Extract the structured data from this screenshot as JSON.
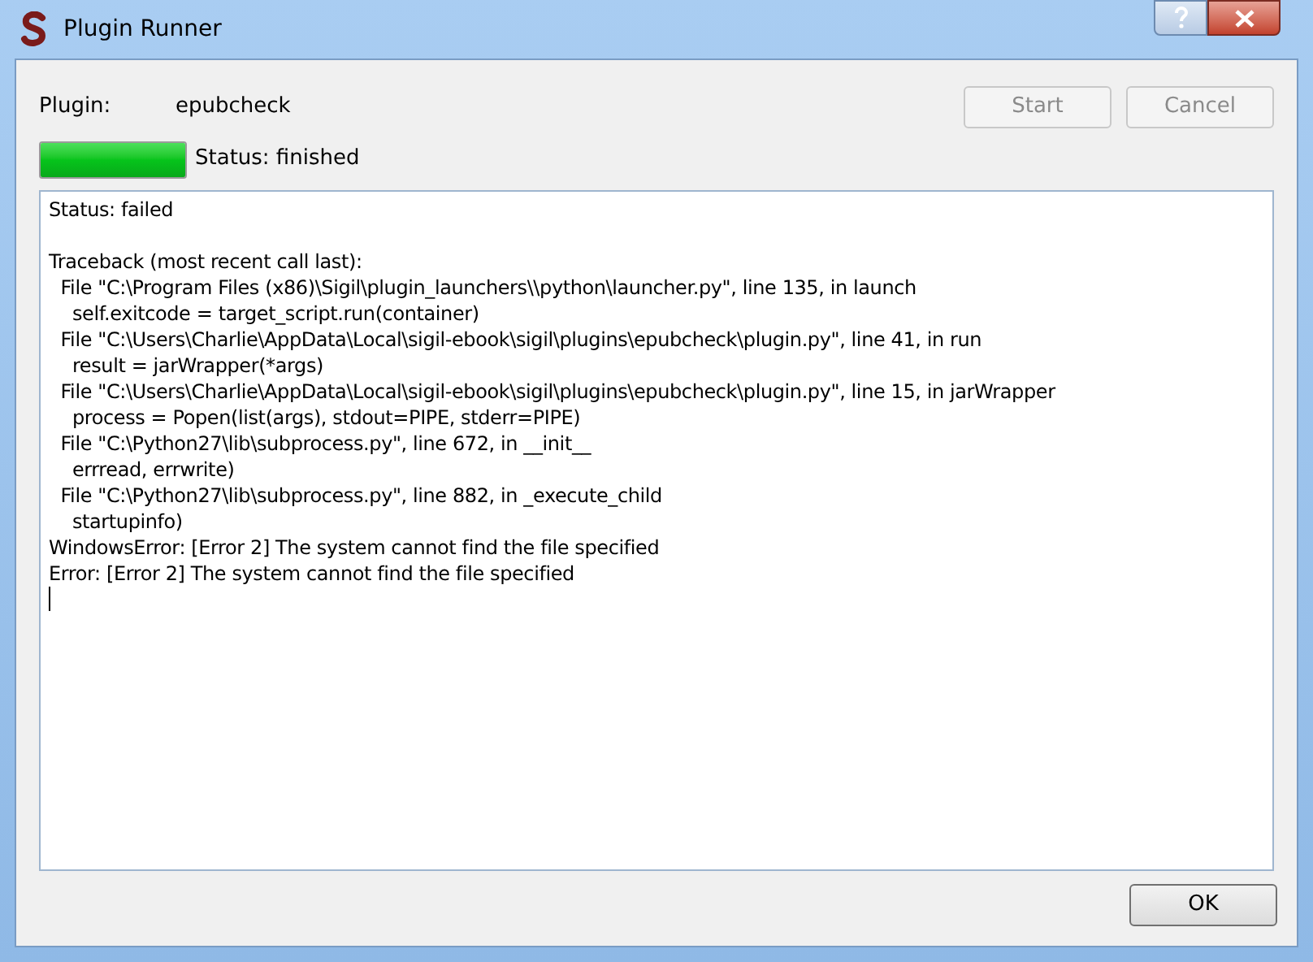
{
  "window": {
    "title": "Plugin Runner"
  },
  "plugin": {
    "label": "Plugin:",
    "value": "epubcheck"
  },
  "buttons": [
    {
      "label": "Start",
      "disabled": true
    },
    {
      "label": "Cancel",
      "disabled": true
    }
  ],
  "progress": {
    "level": 1,
    "status": "Status: finished"
  },
  "output": {
    "text": "Status: failed\n\nTraceback (most recent call last):\n  File \"C:\\Program Files (x86)\\Sigil\\plugin_launchers\\\\python\\launcher.py\", line 135, in launch\n    self.exitcode = target_script.run(container)\n  File \"C:\\Users\\Charlie\\AppData\\Local\\sigil-ebook\\sigil\\plugins\\epubcheck\\plugin.py\", line 41, in run\n    result = jarWrapper(*args)\n  File \"C:\\Users\\Charlie\\AppData\\Local\\sigil-ebook\\sigil\\plugins\\epubcheck\\plugin.py\", line 15, in jarWrapper\n    process = Popen(list(args), stdout=PIPE, stderr=PIPE)\n  File \"C:\\Python27\\lib\\subprocess.py\", line 672, in __init__\n    errread, errwrite)\n  File \"C:\\Python27\\lib\\subprocess.py\", line 882, in _execute_child\n    startupinfo)\nWindowsError: [Error 2] The system cannot find the file specified\nError: [Error 2] The system cannot find the file specified"
  },
  "ok_button": {
    "label": "OK"
  }
}
